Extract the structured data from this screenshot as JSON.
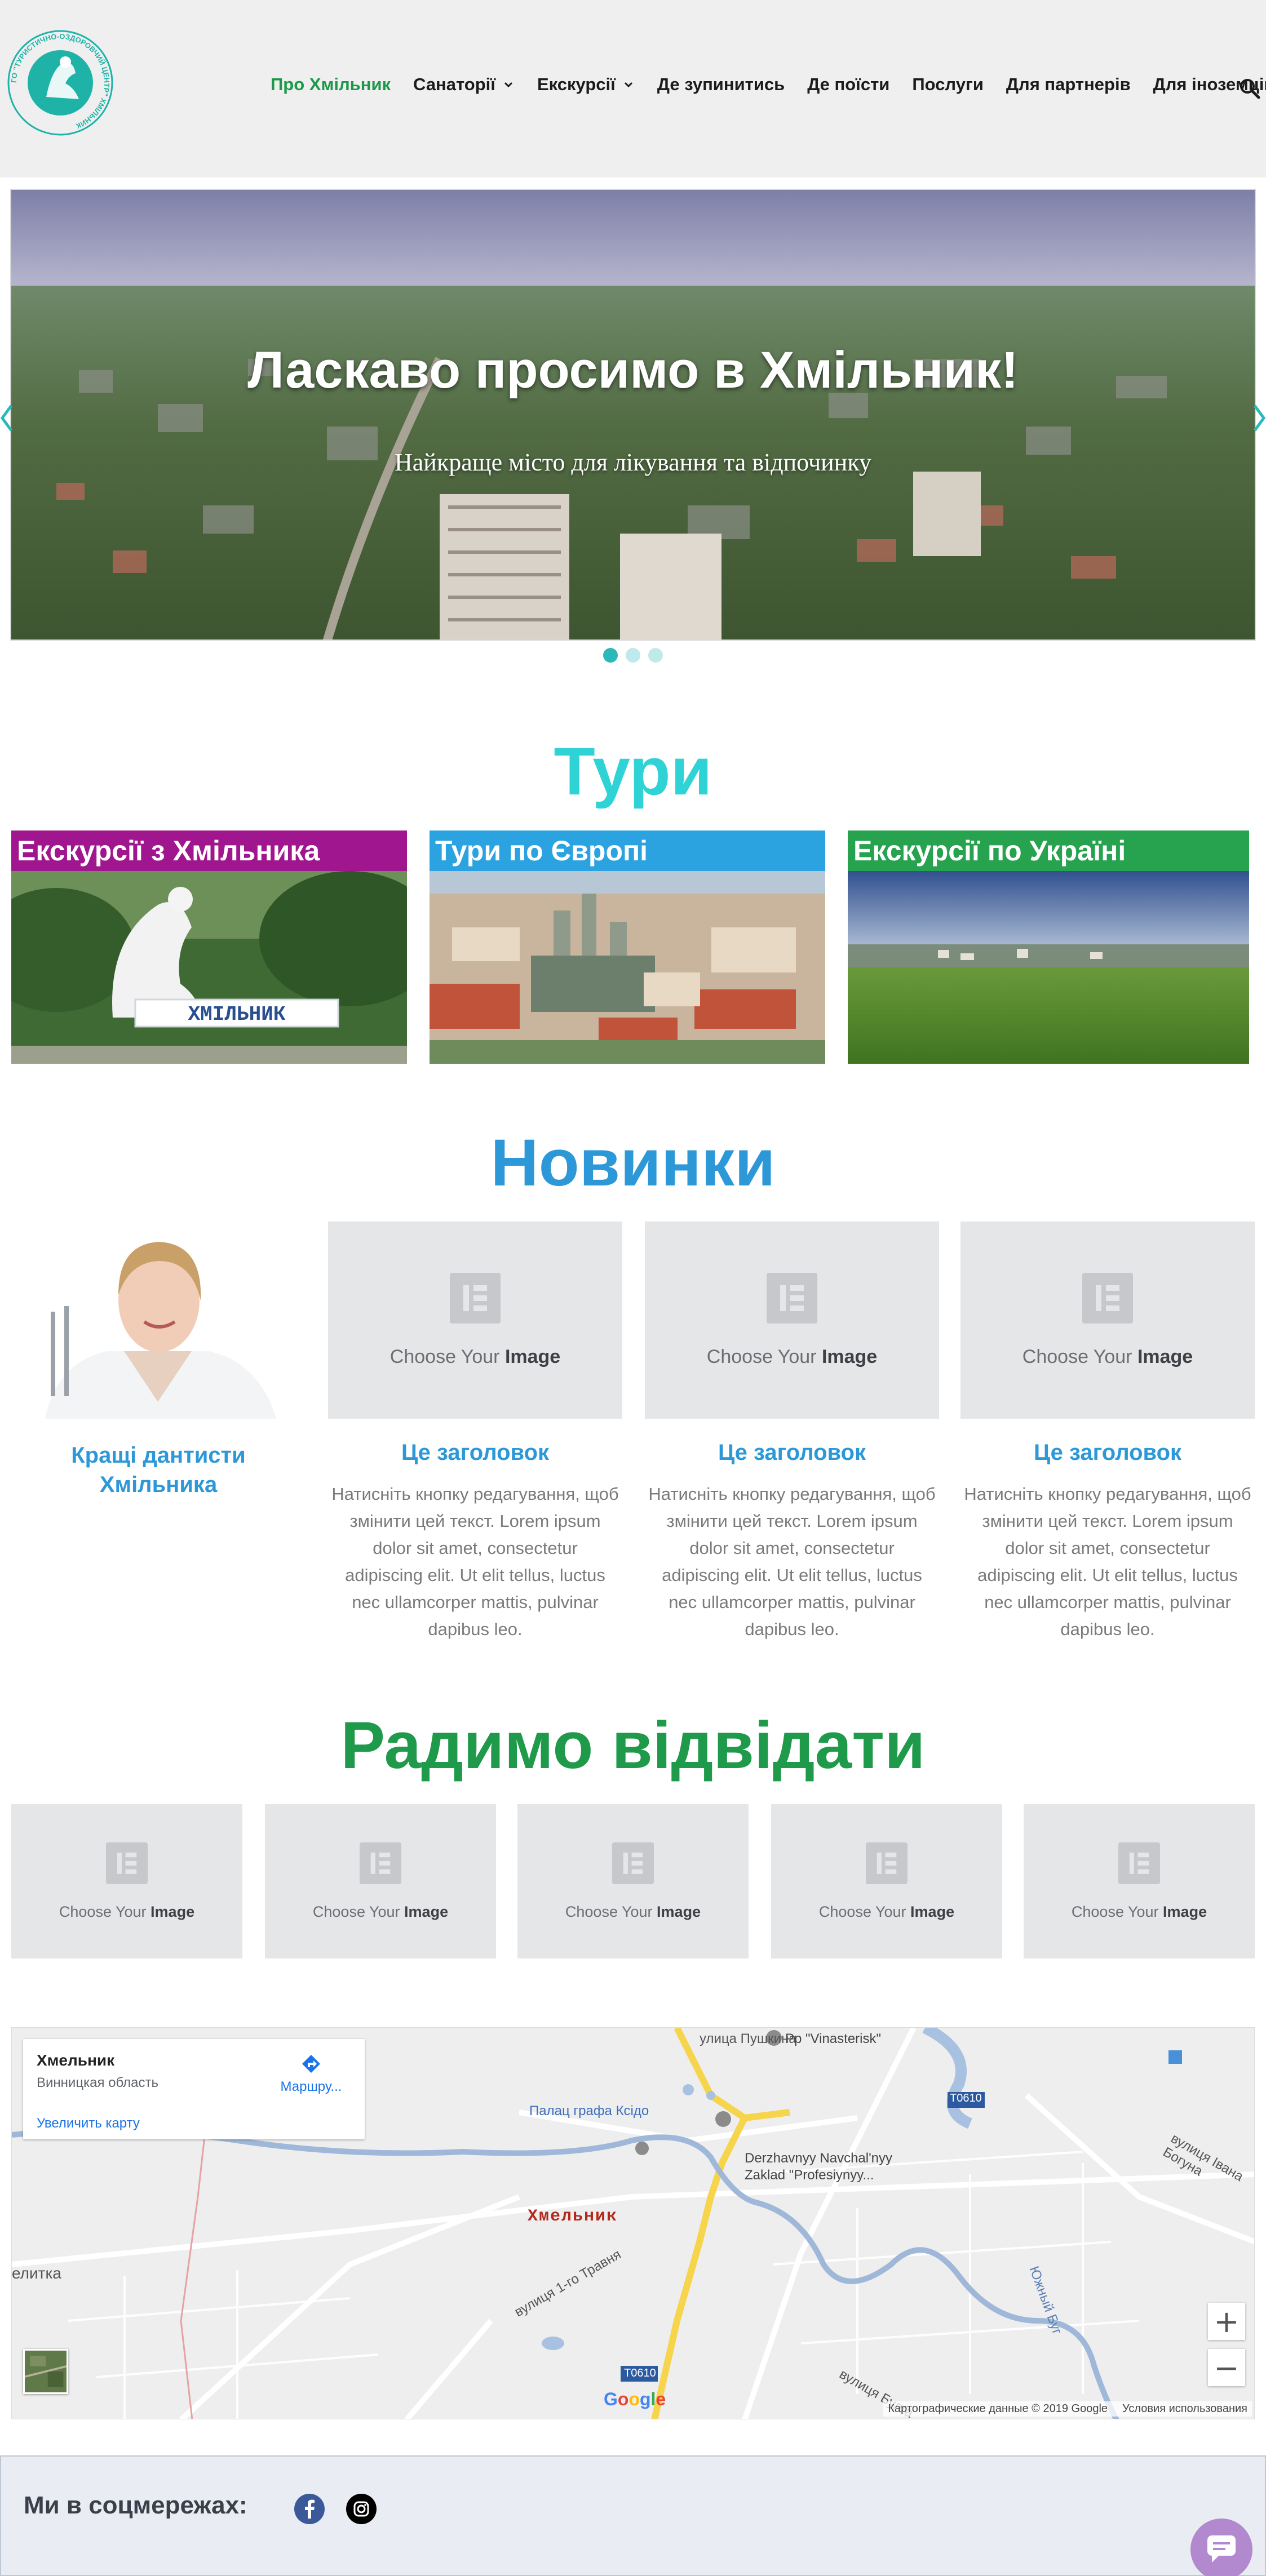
{
  "logo": {
    "text": "ГО \"ТУРИСТИЧНО-ОЗДОРОВЧИЙ ЦЕНТР\" ХМІЛЬНИК"
  },
  "nav": {
    "items": [
      {
        "label": "Про Хмільник",
        "active": true
      },
      {
        "label": "Санаторії",
        "has_dropdown": true
      },
      {
        "label": "Екскурсії",
        "has_dropdown": true
      },
      {
        "label": "Де зупинитись"
      },
      {
        "label": "Де поїсти"
      },
      {
        "label": "Послуги"
      },
      {
        "label": "Для партнерів"
      },
      {
        "label": "Для іноземців"
      }
    ],
    "search_icon": "search-icon",
    "active_color": "#1a9a48"
  },
  "hero": {
    "title": "Ласкаво просимо в Хмільник!",
    "subtitle": "Найкраще місто для лікування та відпочинку",
    "slides_count": 3,
    "active_slide": 1
  },
  "tours": {
    "title": "Тури",
    "title_color": "#2fd3d6",
    "cards": [
      {
        "label": "Екскурсії з Хмільника",
        "color": "#a0168e",
        "sign_text": "ХМІЛЬНИК"
      },
      {
        "label": "Тури по Європі",
        "color": "#2ca3e1"
      },
      {
        "label": "Екскурсії по Україні",
        "color": "#27a24f"
      }
    ]
  },
  "news": {
    "title": "Новинки",
    "title_color": "#2d98d8",
    "featured": {
      "title": "Кращі дантисти Хмільника"
    },
    "placeholder_text_prefix": "Choose Your ",
    "placeholder_text_bold": "Image",
    "items": [
      {
        "title": "Це заголовок",
        "text": "Натисніть кнопку редагування, щоб змінити цей текст. Lorem ipsum dolor sit amet, consectetur adipiscing elit. Ut elit tellus, luctus nec ullamcorper mattis, pulvinar dapibus leo."
      },
      {
        "title": "Це заголовок",
        "text": "Натисніть кнопку редагування, щоб змінити цей текст. Lorem ipsum dolor sit amet, consectetur adipiscing elit. Ut elit tellus, luctus nec ullamcorper mattis, pulvinar dapibus leo."
      },
      {
        "title": "Це заголовок",
        "text": "Натисніть кнопку редагування, щоб змінити цей текст. Lorem ipsum dolor sit amet, consectetur adipiscing elit. Ut elit tellus, luctus nec ullamcorper mattis, pulvinar dapibus leo."
      }
    ]
  },
  "recommend": {
    "title": "Радимо відвідати",
    "title_color": "#1f9a4b",
    "items": [
      {
        "prefix": "Choose Your ",
        "bold": "Image"
      },
      {
        "prefix": "Choose Your ",
        "bold": "Image"
      },
      {
        "prefix": "Choose Your ",
        "bold": "Image"
      },
      {
        "prefix": "Choose Your ",
        "bold": "Image"
      },
      {
        "prefix": "Choose Your ",
        "bold": "Image"
      }
    ]
  },
  "map": {
    "place": "Хмельник",
    "region": "Винницкая область",
    "enlarge_link": "Увеличить карту",
    "route_label": "Маршру...",
    "city_label": "Хмельник",
    "labels": {
      "street_pushkina": "улица Пушкина",
      "vinasterisk": "Pp \"Vinasterisk\"",
      "palace": "Палац графа Ксідо",
      "college_1": "Derzhavnyy Navchal'nyy",
      "college_2": "Zaklad \"Profesiynyy...",
      "road_t0610": "T0610",
      "road_t0610_b": "T0610",
      "street_1": "вулиця 1-го Травня",
      "elitka": "елитка",
      "street_ivana": "вулиця Івана Богуна",
      "street_bug": "Южный Буг",
      "street_small": "вулиця Булга"
    },
    "zoom_in": "+",
    "zoom_out": "−",
    "google": "Google",
    "attribution": "Картографические данные © 2019 Google",
    "terms": "Условия использования"
  },
  "footer": {
    "social_title": "Ми в соцмережах:",
    "facebook_icon": "facebook-icon",
    "instagram_icon": "instagram-icon",
    "chat_icon": "chat-icon"
  }
}
